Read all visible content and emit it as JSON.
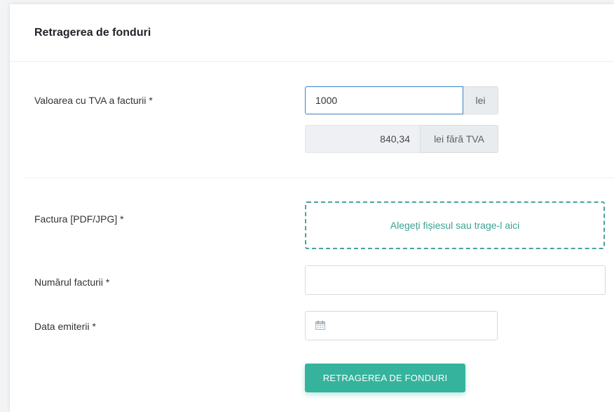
{
  "card": {
    "title": "Retragerea de fonduri"
  },
  "invoice_value": {
    "label": "Valoarea cu TVA a facturii  *",
    "value": "1000",
    "currency": "lei",
    "net_value": "840,34",
    "net_suffix": "lei fără TVA"
  },
  "invoice_file": {
    "label": "Factura [PDF/JPG] *",
    "dropzone_text": "Alegeți fișiesul sau trage-l aici"
  },
  "invoice_number": {
    "label": "Numărul facturii *",
    "value": ""
  },
  "issue_date": {
    "label": "Data emiterii *",
    "value": "",
    "icon": "calendar-icon"
  },
  "submit": {
    "label": "RETRAGEREA DE FONDURI"
  },
  "colors": {
    "accent": "#35b39c",
    "focus_border": "#3b82c4"
  }
}
